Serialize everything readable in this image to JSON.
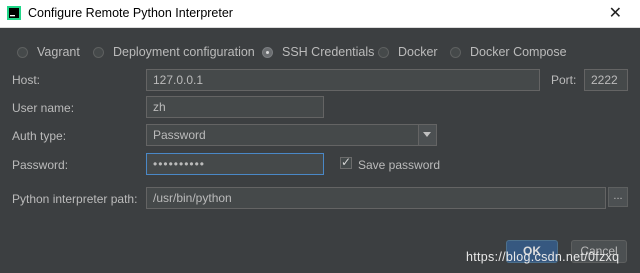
{
  "window": {
    "title": "Configure Remote Python Interpreter",
    "close_glyph": "✕"
  },
  "connection_types": [
    {
      "label": "Vagrant",
      "selected": false
    },
    {
      "label": "Deployment configuration",
      "selected": false
    },
    {
      "label": "SSH Credentials",
      "selected": true
    },
    {
      "label": "Docker",
      "selected": false
    },
    {
      "label": "Docker Compose",
      "selected": false
    }
  ],
  "form": {
    "host_label": "Host:",
    "host_value": "127.0.0.1",
    "port_label": "Port:",
    "port_value": "2222",
    "username_label": "User name:",
    "username_value": "zh",
    "auth_type_label": "Auth type:",
    "auth_type_value": "Password",
    "password_label": "Password:",
    "password_value": "••••••••••",
    "save_password_label": "Save password",
    "save_password_checked": true,
    "interpreter_path_label": "Python interpreter path:",
    "interpreter_path_value": "/usr/bin/python",
    "browse_label": "..."
  },
  "buttons": {
    "ok": "OK",
    "cancel": "Cancel"
  },
  "watermark": "https://blog.csdn.net/0fzxq",
  "colors": {
    "dialog_bg": "#3c3f41",
    "field_bg": "#45494a",
    "focus_border": "#4a88c7",
    "ok_button": "#365880"
  }
}
